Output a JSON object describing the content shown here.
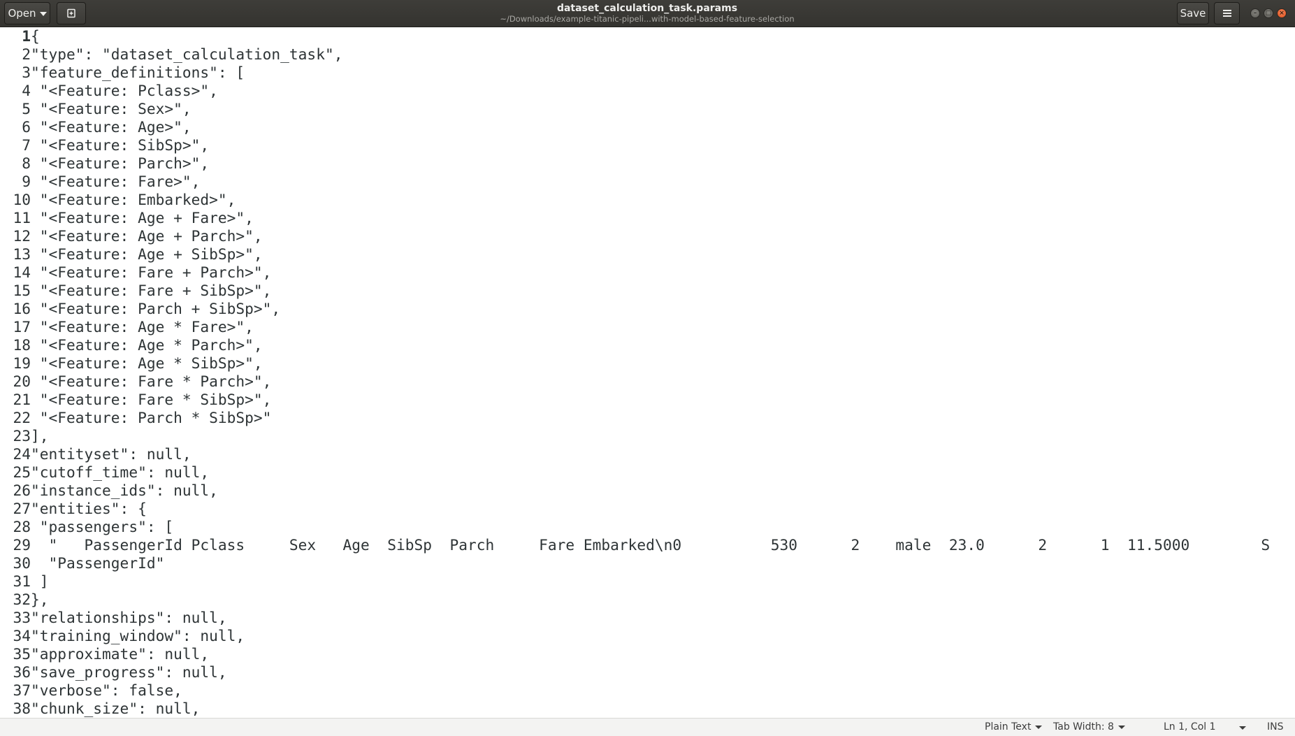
{
  "window": {
    "title": "dataset_calculation_task.params",
    "subtitle": "~/Downloads/example-titanic-pipeli...with-model-based-feature-selection"
  },
  "toolbar": {
    "open_label": "Open",
    "new_doc_icon": "document-new-icon",
    "save_label": "Save",
    "menu_icon": "hamburger-menu-icon"
  },
  "window_controls": [
    "minimize-icon",
    "maximize-icon",
    "close-icon"
  ],
  "editor": {
    "current_line": 1,
    "lines": [
      "{",
      "\"type\": \"dataset_calculation_task\",",
      "\"feature_definitions\": [",
      " \"<Feature: Pclass>\",",
      " \"<Feature: Sex>\",",
      " \"<Feature: Age>\",",
      " \"<Feature: SibSp>\",",
      " \"<Feature: Parch>\",",
      " \"<Feature: Fare>\",",
      " \"<Feature: Embarked>\",",
      " \"<Feature: Age + Fare>\",",
      " \"<Feature: Age + Parch>\",",
      " \"<Feature: Age + SibSp>\",",
      " \"<Feature: Fare + Parch>\",",
      " \"<Feature: Fare + SibSp>\",",
      " \"<Feature: Parch + SibSp>\",",
      " \"<Feature: Age * Fare>\",",
      " \"<Feature: Age * Parch>\",",
      " \"<Feature: Age * SibSp>\",",
      " \"<Feature: Fare * Parch>\",",
      " \"<Feature: Fare * SibSp>\",",
      " \"<Feature: Parch * SibSp>\"",
      "],",
      "\"entityset\": null,",
      "\"cutoff_time\": null,",
      "\"instance_ids\": null,",
      "\"entities\": {",
      " \"passengers\": [",
      "  \"   PassengerId Pclass     Sex   Age  SibSp  Parch     Fare Embarked\\n0          530      2    male  23.0      2      1  11.5000        S",
      "  \"PassengerId\"",
      " ]",
      "},",
      "\"relationships\": null,",
      "\"training_window\": null,",
      "\"approximate\": null,",
      "\"save_progress\": null,",
      "\"verbose\": false,",
      "\"chunk_size\": null,"
    ]
  },
  "statusbar": {
    "language": "Plain Text",
    "tab_width": "Tab Width: 8",
    "position": "Ln 1, Col 1",
    "mode": "INS"
  }
}
